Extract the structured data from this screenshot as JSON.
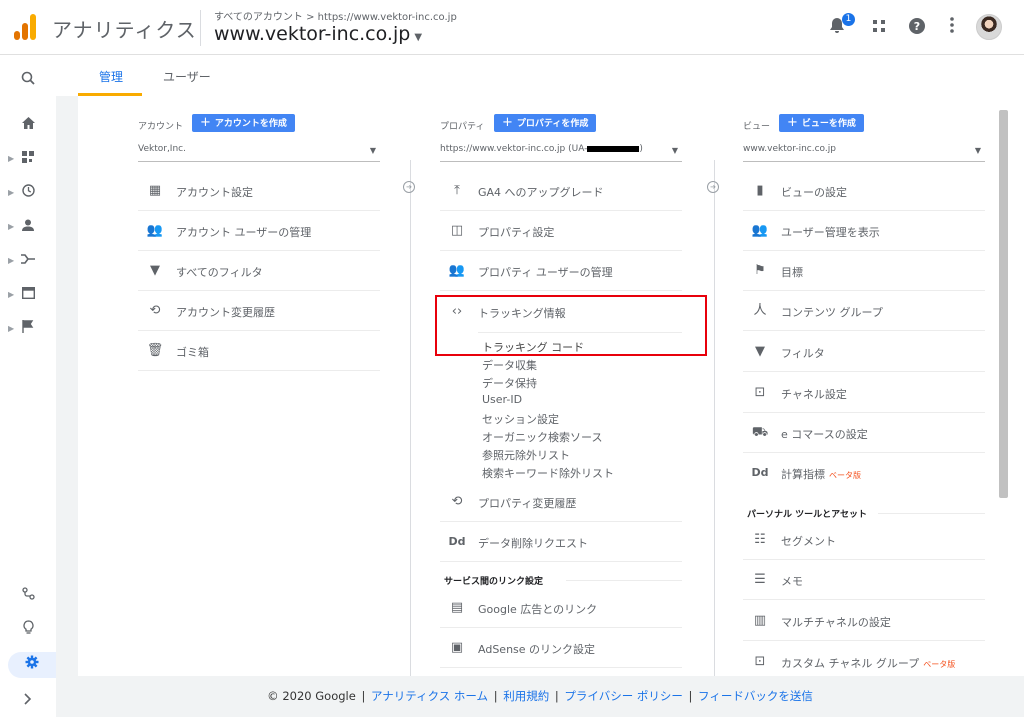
{
  "header": {
    "app_title": "アナリティクス",
    "breadcrumb": "すべてのアカウント > https://www.vektor-inc.co.jp",
    "account_name": "www.vektor-inc.co.jp",
    "notification_count": "1",
    "logo_colors": [
      "#f9ab00",
      "#e37400",
      "#e37400"
    ]
  },
  "tabs": [
    {
      "label": "管理",
      "active": true
    },
    {
      "label": "ユーザー",
      "active": false
    }
  ],
  "columns": {
    "account": {
      "label": "アカウント",
      "create_label": "アカウントを作成",
      "selected": "Vektor,Inc.",
      "items": [
        {
          "icon": "building-icon",
          "label": "アカウント設定"
        },
        {
          "icon": "users-icon",
          "label": "アカウント ユーザーの管理"
        },
        {
          "icon": "filter-icon",
          "label": "すべてのフィルタ"
        },
        {
          "icon": "history-icon",
          "label": "アカウント変更履歴"
        },
        {
          "icon": "trash-icon",
          "label": "ゴミ箱"
        }
      ]
    },
    "property": {
      "label": "プロパティ",
      "create_label": "プロパティを作成",
      "selected": "https://www.vektor-inc.co.jp (UA-",
      "selected_suffix": ")",
      "items": [
        {
          "icon": "upload-icon",
          "label": "GA4 へのアップグレード"
        },
        {
          "icon": "window-icon",
          "label": "プロパティ設定"
        },
        {
          "icon": "users-icon",
          "label": "プロパティ ユーザーの管理"
        },
        {
          "icon": "code-icon",
          "label": "トラッキング情報"
        }
      ],
      "tracking_subitems": [
        "トラッキング コード",
        "データ収集",
        "データ保持",
        "User-ID",
        "セッション設定",
        "オーガニック検索ソース",
        "参照元除外リスト",
        "検索キーワード除外リスト"
      ],
      "items2": [
        {
          "icon": "history-icon",
          "label": "プロパティ変更履歴"
        },
        {
          "icon": "dd-icon",
          "label": "データ削除リクエスト"
        }
      ],
      "section": "サービス間のリンク設定",
      "items3": [
        {
          "icon": "ads-icon",
          "label": "Google 広告とのリンク"
        },
        {
          "icon": "adsense-icon",
          "label": "AdSense のリンク設定"
        }
      ]
    },
    "view": {
      "label": "ビュー",
      "create_label": "ビューを作成",
      "selected": "www.vektor-inc.co.jp",
      "items": [
        {
          "icon": "document-icon",
          "label": "ビューの設定"
        },
        {
          "icon": "users-icon",
          "label": "ユーザー管理を表示"
        },
        {
          "icon": "flag-icon",
          "label": "目標"
        },
        {
          "icon": "person-walk-icon",
          "label": "コンテンツ グループ"
        },
        {
          "icon": "filter-icon",
          "label": "フィルタ"
        },
        {
          "icon": "channel-icon",
          "label": "チャネル設定"
        },
        {
          "icon": "cart-icon",
          "label": "e コマースの設定"
        },
        {
          "icon": "dd-icon",
          "label": "計算指標",
          "beta": "ベータ版"
        }
      ],
      "section": "パーソナル ツールとアセット",
      "items2": [
        {
          "icon": "segment-icon",
          "label": "セグメント"
        },
        {
          "icon": "note-icon",
          "label": "メモ"
        },
        {
          "icon": "bar-chart-icon",
          "label": "マルチチャネルの設定"
        },
        {
          "icon": "channel-icon",
          "label": "カスタム チャネル グループ",
          "beta": "ベータ版"
        }
      ]
    }
  },
  "footer": {
    "copyright": "© 2020 Google",
    "links": [
      "アナリティクス ホーム",
      "利用規約",
      "プライバシー ポリシー",
      "フィードバックを送信"
    ]
  },
  "colors": {
    "accent": "#1a73e8",
    "button": "#4285f4",
    "highlight_box": "#e8000b",
    "tab_underline": "#f9ab00"
  }
}
